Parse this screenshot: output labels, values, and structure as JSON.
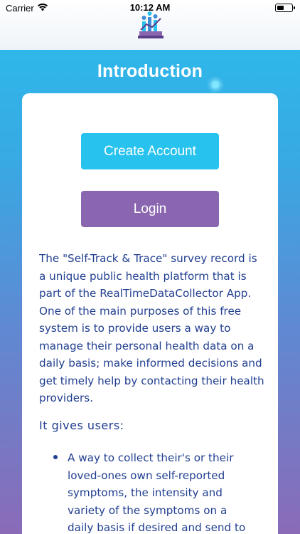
{
  "status_bar": {
    "carrier": "Carrier",
    "time": "10:12 AM",
    "battery_level": 0.5
  },
  "header": {
    "logo": "app-logo-icon"
  },
  "page": {
    "title": "Introduction"
  },
  "buttons": {
    "create_account": "Create Account",
    "login": "Login"
  },
  "content": {
    "description": "The \"Self-Track & Trace\" survey record is a unique public health platform that is part of the RealTimeDataCollector App. One of the main purposes of this free system is to provide users a way to manage their personal health data on a daily basis; make informed decisions and get timely help by contacting their health providers.",
    "subheading": "It gives users:",
    "bullets": [
      "A way to collect their's or their loved-ones own self-reported symptoms, the intensity and variety of the symptoms on a daily basis if desired and send to own email to"
    ]
  },
  "colors": {
    "create_button": "#27c3ee",
    "login_button": "#8b66b0",
    "text": "#213f90"
  }
}
